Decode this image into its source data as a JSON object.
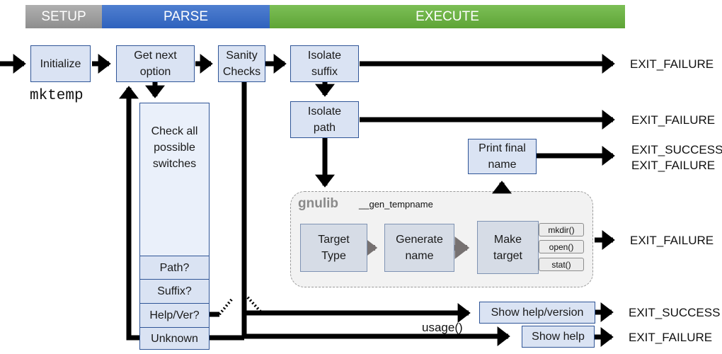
{
  "phases": {
    "setup": "SETUP",
    "parse": "PARSE",
    "execute": "EXECUTE"
  },
  "colors": {
    "setup": "#9e9e9e",
    "parse": "#3a6cc6",
    "execute": "#6aad42",
    "box_fill": "#dae3f3",
    "box_border": "#2f5597"
  },
  "program_name": "mktemp",
  "nodes": {
    "initialize": "Initialize",
    "get_next_option": "Get next\noption",
    "sanity_checks": "Sanity\nChecks",
    "isolate_suffix": "Isolate\nsuffix",
    "isolate_path": "Isolate\npath",
    "check_switches": "Check all\npossible\nswitches",
    "path_q": "Path?",
    "suffix_q": "Suffix?",
    "helpver_q": "Help/Ver?",
    "unknown": "Unknown",
    "print_final_name": "Print final\nname",
    "show_help_version": "Show help/version",
    "show_help": "Show help"
  },
  "gnulib": {
    "title": "gnulib",
    "function": "__gen_tempname",
    "steps": [
      "Target\nType",
      "Generate\nname",
      "Make\ntarget"
    ],
    "calls": [
      "mkdir()",
      "open()",
      "stat()"
    ]
  },
  "exits": {
    "suffix_fail": "EXIT_FAILURE",
    "path_fail": "EXIT_FAILURE",
    "print_result": "EXIT_SUCCESS\nEXIT_FAILURE",
    "gnulib_fail": "EXIT_FAILURE",
    "help_success": "EXIT_SUCCESS",
    "help_fail": "EXIT_FAILURE"
  },
  "edge_labels": {
    "usage": "usage()"
  }
}
